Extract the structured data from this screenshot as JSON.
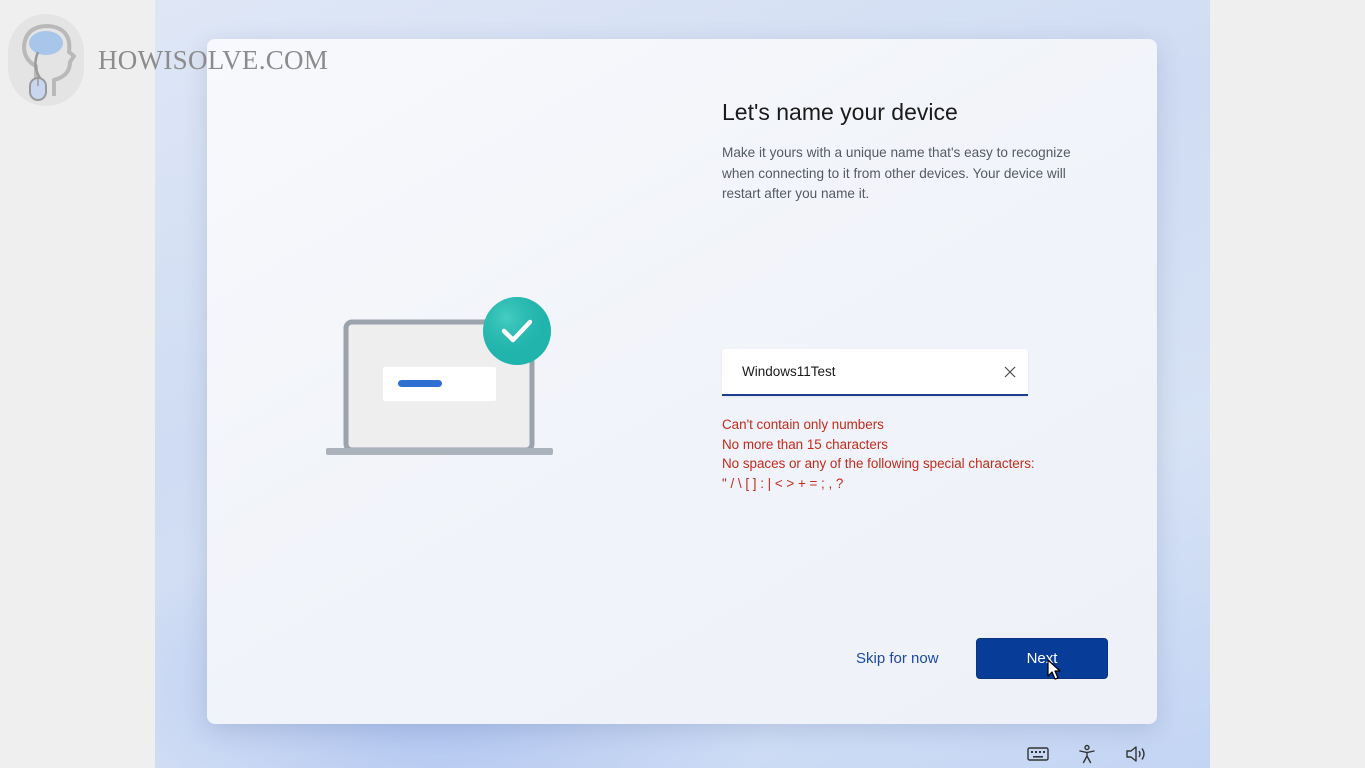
{
  "brand": {
    "name": "HOWISOLVE.COM"
  },
  "setup": {
    "title": "Let's name your device",
    "description": "Make it yours with a unique name that's easy to recognize when connecting to it from other devices. Your device will restart after you name it.",
    "device_name": {
      "value": "Windows11Test",
      "placeholder": ""
    },
    "validation_errors": [
      "Can't contain only numbers",
      "No more than 15 characters",
      "No spaces or any of the following special characters:",
      "\" / \\ [ ] : | < > + = ; , ?"
    ],
    "skip_label": "Skip for now",
    "next_label": "Next"
  },
  "tray": {
    "icons": [
      "keyboard-icon",
      "accessibility-icon",
      "volume-icon"
    ]
  },
  "colors": {
    "accent": "#083c99",
    "error": "#c42b1c",
    "checkmark": "#1fb5ad"
  }
}
